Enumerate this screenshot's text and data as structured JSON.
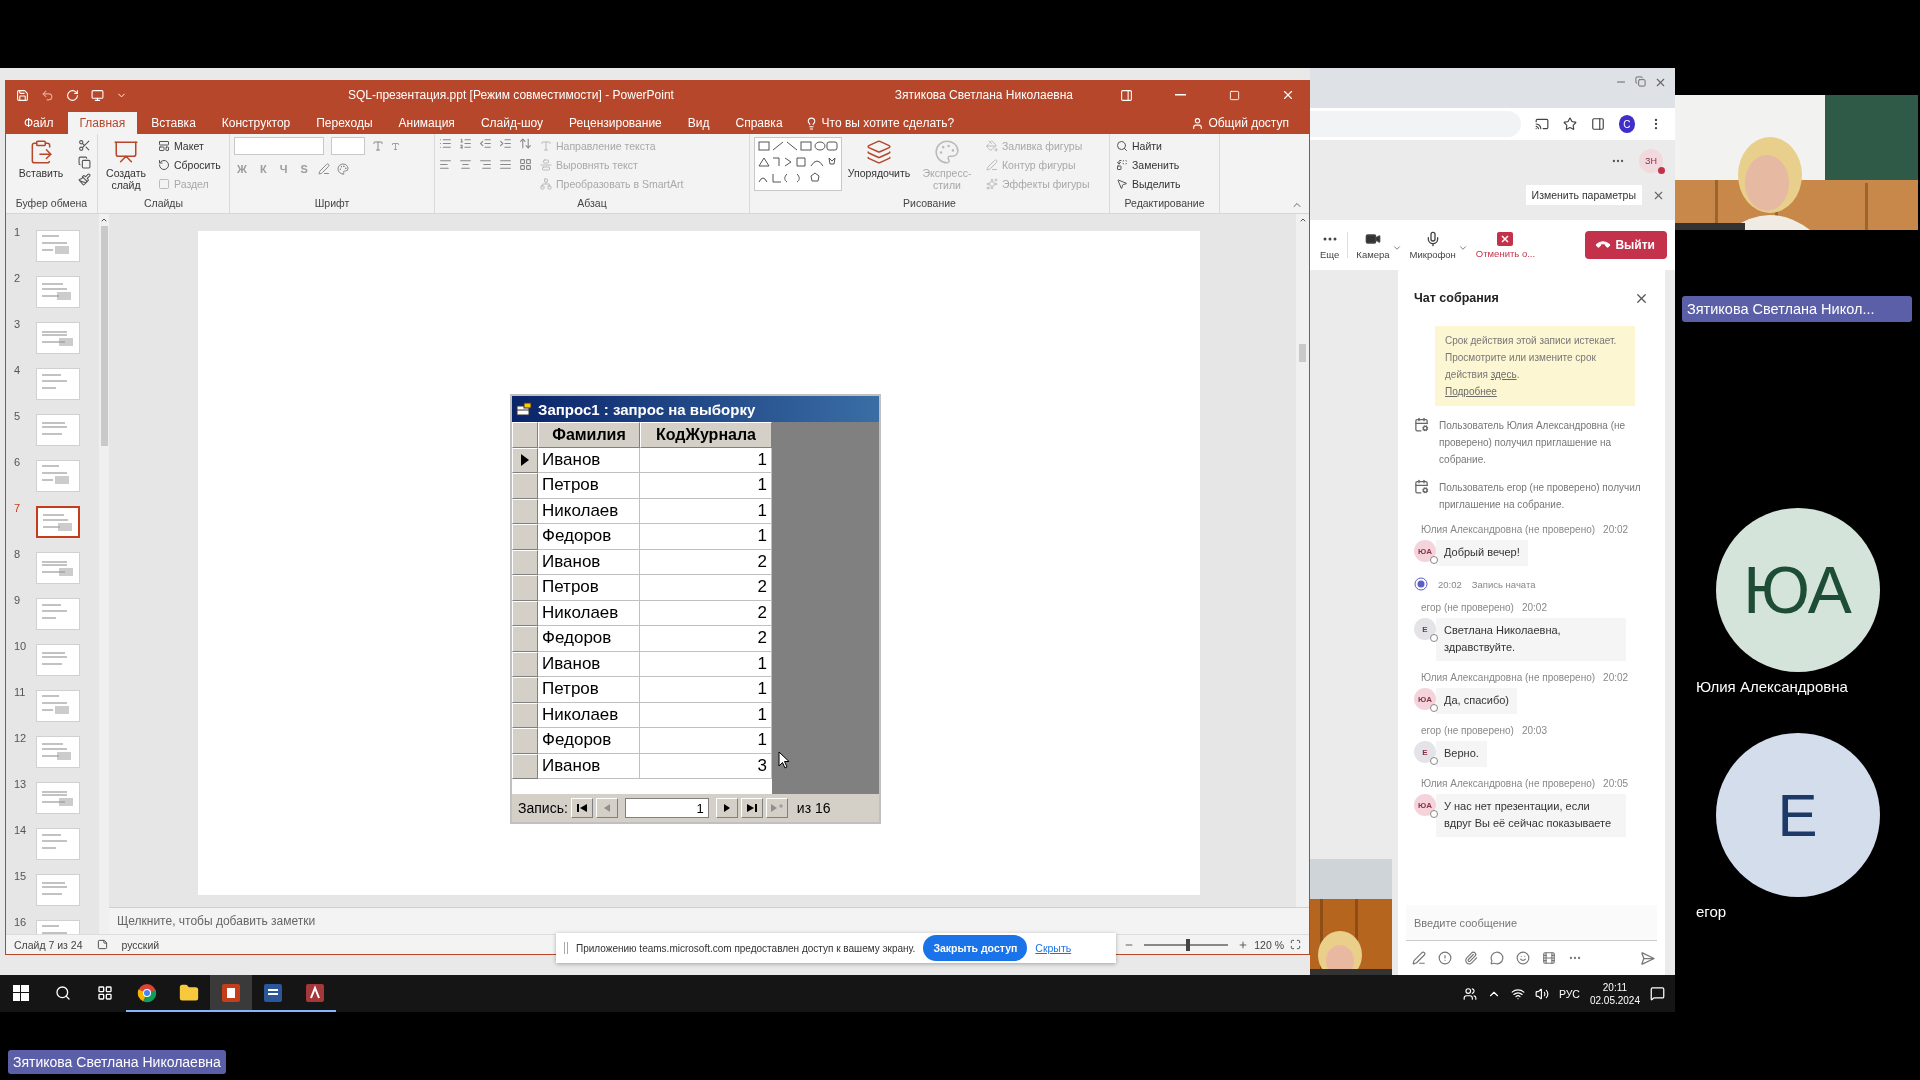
{
  "powerpoint": {
    "title": "SQL-презентация.ppt [Режим совместимости] - PowerPoint",
    "user": "Зятикова Светлана Николаевна",
    "tabs": [
      {
        "label": "Файл",
        "selected": false
      },
      {
        "label": "Главная",
        "selected": true
      },
      {
        "label": "Вставка",
        "selected": false
      },
      {
        "label": "Конструктор",
        "selected": false
      },
      {
        "label": "Переходы",
        "selected": false
      },
      {
        "label": "Анимация",
        "selected": false
      },
      {
        "label": "Слайд-шоу",
        "selected": false
      },
      {
        "label": "Рецензирование",
        "selected": false
      },
      {
        "label": "Вид",
        "selected": false
      },
      {
        "label": "Справка",
        "selected": false
      }
    ],
    "tell_me": "Что вы хотите сделать?",
    "share": "Общий доступ",
    "ribbon": [
      {
        "label": "Буфер обмена",
        "commands": [
          {
            "kind": "large",
            "label": "Вставить",
            "disabled": false
          }
        ]
      },
      {
        "label": "Слайды",
        "commands": [
          {
            "kind": "large",
            "label": "Создать слайд",
            "disabled": false
          },
          {
            "kind": "small",
            "label": "Макет",
            "disabled": false
          },
          {
            "kind": "small",
            "label": "Сбросить",
            "disabled": false
          },
          {
            "kind": "small",
            "label": "Раздел",
            "disabled": true
          }
        ]
      },
      {
        "label": "Шрифт",
        "commands": [
          {
            "kind": "glyph",
            "label": "Ж",
            "disabled": true
          },
          {
            "kind": "glyph",
            "label": "К",
            "disabled": true
          },
          {
            "kind": "glyph",
            "label": "Ч",
            "disabled": true
          },
          {
            "kind": "glyph",
            "label": "S",
            "disabled": true
          }
        ]
      },
      {
        "label": "Абзац",
        "commands": [
          {
            "kind": "small",
            "label": "Направление текста",
            "disabled": true
          },
          {
            "kind": "small",
            "label": "Выровнять текст",
            "disabled": true
          },
          {
            "kind": "small",
            "label": "Преобразовать в SmartArt",
            "disabled": true
          }
        ]
      },
      {
        "label": "Рисование",
        "commands": [
          {
            "kind": "large",
            "label": "Упорядочить",
            "disabled": false
          },
          {
            "kind": "large",
            "label": "Экспресс-стили",
            "disabled": true
          },
          {
            "kind": "small",
            "label": "Заливка фигуры",
            "disabled": true
          },
          {
            "kind": "small",
            "label": "Контур фигуры",
            "disabled": true
          },
          {
            "kind": "small",
            "label": "Эффекты фигуры",
            "disabled": true
          }
        ]
      },
      {
        "label": "Редактирование",
        "commands": [
          {
            "kind": "small",
            "label": "Найти",
            "disabled": false
          },
          {
            "kind": "small",
            "label": "Заменить",
            "disabled": false
          },
          {
            "kind": "small",
            "label": "Выделить",
            "disabled": false
          }
        ]
      }
    ],
    "thumbnails": [
      {
        "number": "1",
        "selected": false
      },
      {
        "number": "2",
        "selected": false
      },
      {
        "number": "3",
        "selected": false
      },
      {
        "number": "4",
        "selected": false
      },
      {
        "number": "5",
        "selected": false
      },
      {
        "number": "6",
        "selected": false
      },
      {
        "number": "7",
        "selected": true
      },
      {
        "number": "8",
        "selected": false
      },
      {
        "number": "9",
        "selected": false
      },
      {
        "number": "10",
        "selected": false
      },
      {
        "number": "11",
        "selected": false
      },
      {
        "number": "12",
        "selected": false
      },
      {
        "number": "13",
        "selected": false
      },
      {
        "number": "14",
        "selected": false
      },
      {
        "number": "15",
        "selected": false
      },
      {
        "number": "16",
        "selected": false
      }
    ],
    "slide": {
      "datasheet": {
        "title": "Запрос1 : запрос на выборку",
        "columns": [
          "Фамилия",
          "КодЖурнала"
        ],
        "rows": [
          {
            "cells": [
              "Иванов",
              "1"
            ],
            "selected": true
          },
          {
            "cells": [
              "Петров",
              "1"
            ],
            "selected": false
          },
          {
            "cells": [
              "Николаев",
              "1"
            ],
            "selected": false
          },
          {
            "cells": [
              "Федоров",
              "1"
            ],
            "selected": false
          },
          {
            "cells": [
              "Иванов",
              "2"
            ],
            "selected": false
          },
          {
            "cells": [
              "Петров",
              "2"
            ],
            "selected": false
          },
          {
            "cells": [
              "Николаев",
              "2"
            ],
            "selected": false
          },
          {
            "cells": [
              "Федоров",
              "2"
            ],
            "selected": false
          },
          {
            "cells": [
              "Иванов",
              "1"
            ],
            "selected": false
          },
          {
            "cells": [
              "Петров",
              "1"
            ],
            "selected": false
          },
          {
            "cells": [
              "Николаев",
              "1"
            ],
            "selected": false
          },
          {
            "cells": [
              "Федоров",
              "1"
            ],
            "selected": false
          },
          {
            "cells": [
              "Иванов",
              "3"
            ],
            "selected": false
          }
        ],
        "nav": {
          "label": "Запись:",
          "current": "1",
          "total": "из 16",
          "buttons": [
            {
              "kind": "first",
              "disabled": false
            },
            {
              "kind": "prev",
              "disabled": true
            },
            {
              "kind": "next",
              "disabled": false
            },
            {
              "kind": "last",
              "disabled": false
            },
            {
              "kind": "new",
              "disabled": true
            }
          ]
        }
      }
    },
    "notes_prompt": "Щелкните, чтобы добавить заметки",
    "status": {
      "slide_counter": "Слайд 7 из 24",
      "language": "русский",
      "zoom": {
        "level": 0.52,
        "reading": "120 %"
      }
    }
  },
  "share_bar": {
    "text": "Приложению teams.microsoft.com предоставлен доступ к вашему экрану.",
    "stop": "Закрыть доступ",
    "hide": "Скрыть"
  },
  "browser": {
    "profile_initial": "C",
    "teams_user_initials": "ЗН",
    "tooltip": "Изменить параметры",
    "meeting_toolbar": [
      {
        "kind": "more",
        "label": "Еще"
      },
      {
        "kind": "camera",
        "label": "Камера"
      },
      {
        "kind": "mic",
        "label": "Микрофон"
      },
      {
        "kind": "stop",
        "label": "Отменить о..."
      }
    ],
    "leave": "Выйти",
    "chat": {
      "title": "Чат собрания",
      "notice": {
        "text": "Срок действия этой записи истекает. Просмотрите или измените срок действия ",
        "link": "здесь",
        "after": ".",
        "more": "Подробнее"
      },
      "events": [
        {
          "kind": "system",
          "text": "Пользователь Юлия Александровна (не проверено) получил приглашение на собрание."
        },
        {
          "kind": "system",
          "text": "Пользователь егор (не проверено) получил приглашение на собрание."
        },
        {
          "kind": "message",
          "author": "Юлия Александровна (не проверено)",
          "time": "20:02",
          "initials": "ЮА",
          "color": "#f5d3db",
          "text": "Добрый вечер!"
        },
        {
          "kind": "recording",
          "time": "20:02",
          "text": "Запись начата"
        },
        {
          "kind": "message",
          "author": "егор (не проверено)",
          "time": "20:02",
          "initials": "Е",
          "color": "#e3e3e8",
          "text": "Светлана Николаевна, здравствуйте."
        },
        {
          "kind": "message",
          "author": "Юлия Александровна (не проверено)",
          "time": "20:02",
          "initials": "ЮА",
          "color": "#f5d3db",
          "text": "Да, спасибо)"
        },
        {
          "kind": "message",
          "author": "егор (не проверено)",
          "time": "20:03",
          "initials": "Е",
          "color": "#e3e3e8",
          "text": "Верно."
        },
        {
          "kind": "message",
          "author": "Юлия Александровна (не проверено)",
          "time": "20:05",
          "initials": "ЮА",
          "color": "#f5d3db",
          "text": "У нас нет презентации, если вдруг Вы её сейчас показываете"
        }
      ],
      "compose": {
        "placeholder": "Введите сообщение"
      }
    }
  },
  "taskbar": {
    "apps": [
      {
        "kind": "chrome",
        "selected": false
      },
      {
        "kind": "explorer",
        "selected": false
      },
      {
        "kind": "powerpoint",
        "selected": true
      },
      {
        "kind": "word",
        "selected": false
      },
      {
        "kind": "access",
        "selected": false
      }
    ],
    "language": "РУС",
    "time": "20:11",
    "date": "02.05.2024"
  },
  "screen_owner_label": "Зятикова Светлана Николаевна",
  "participants": {
    "presenter_label": "Зятикова Светлана Никол...",
    "tiles": [
      {
        "initials": "ЮА",
        "name": "Юлия Александровна",
        "color": "#d5e4da"
      },
      {
        "initials": "Е",
        "name": "егор",
        "color": "#d3ddec"
      }
    ]
  }
}
